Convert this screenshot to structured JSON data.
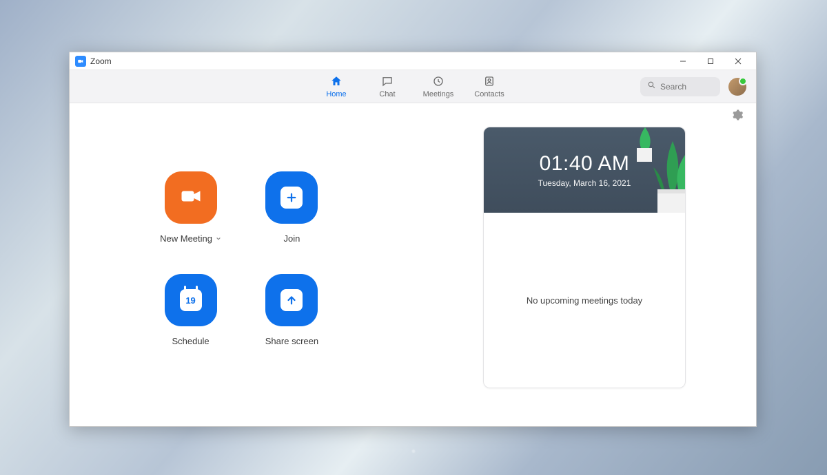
{
  "titlebar": {
    "title": "Zoom"
  },
  "nav": {
    "home": {
      "label": "Home"
    },
    "chat": {
      "label": "Chat"
    },
    "meetings": {
      "label": "Meetings"
    },
    "contacts": {
      "label": "Contacts"
    }
  },
  "search": {
    "placeholder": "Search"
  },
  "actions": {
    "new_meeting": {
      "label": "New Meeting"
    },
    "join": {
      "label": "Join"
    },
    "schedule": {
      "label": "Schedule",
      "day": "19"
    },
    "share_screen": {
      "label": "Share screen"
    }
  },
  "info_card": {
    "time": "01:40 AM",
    "date": "Tuesday, March 16, 2021",
    "empty_state": "No upcoming meetings today"
  }
}
